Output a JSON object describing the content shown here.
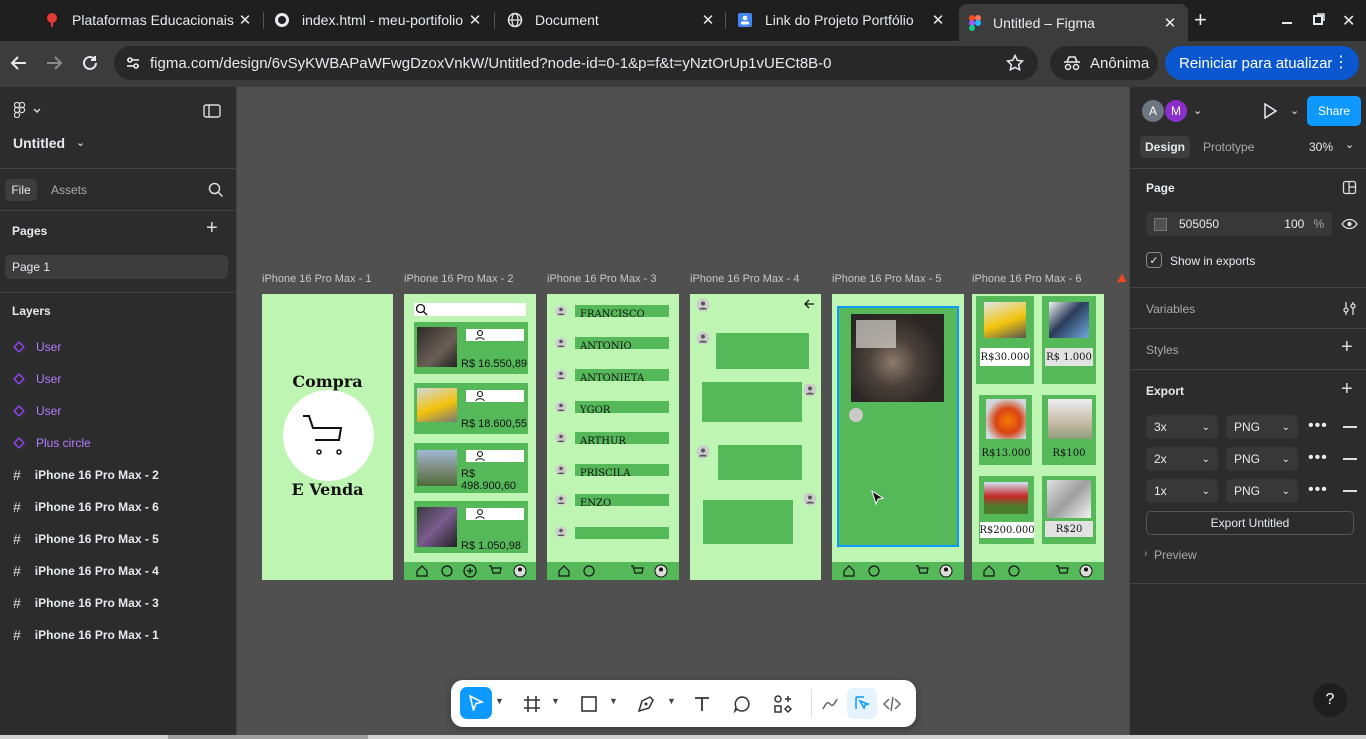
{
  "browser": {
    "tabs": [
      {
        "title": "Plataformas Educacionais",
        "icon": "pin-icon"
      },
      {
        "title": "index.html - meu-portifolio",
        "icon": "github-icon"
      },
      {
        "title": "Document",
        "icon": "globe-icon"
      },
      {
        "title": "Link do Projeto Portfólio",
        "icon": "docs-icon"
      },
      {
        "title": "Untitled – Figma",
        "icon": "figma-icon"
      }
    ],
    "url": "figma.com/design/6vSyKWBAPaWFwgDzoxVnkW/Untitled?node-id=0-1&p=f&t=yNztOrUp1vUECt8B-0",
    "profile_label": "Anônima",
    "update_label": "Reiniciar para atualizar"
  },
  "left_panel": {
    "file_name": "Untitled",
    "tab_file": "File",
    "tab_assets": "Assets",
    "pages_heading": "Pages",
    "page_1": "Page 1",
    "layers_heading": "Layers",
    "layers": [
      {
        "name": "User",
        "kind": "component"
      },
      {
        "name": "User",
        "kind": "component"
      },
      {
        "name": "User",
        "kind": "component"
      },
      {
        "name": "Plus circle",
        "kind": "component"
      },
      {
        "name": "iPhone 16 Pro Max - 2",
        "kind": "frame"
      },
      {
        "name": "iPhone 16 Pro Max - 6",
        "kind": "frame"
      },
      {
        "name": "iPhone 16 Pro Max - 5",
        "kind": "frame"
      },
      {
        "name": "iPhone 16 Pro Max - 4",
        "kind": "frame"
      },
      {
        "name": "iPhone 16 Pro Max - 3",
        "kind": "frame"
      },
      {
        "name": "iPhone 16 Pro Max - 1",
        "kind": "frame"
      }
    ]
  },
  "canvas": {
    "frames": [
      "iPhone 16 Pro Max - 1",
      "iPhone 16 Pro Max - 2",
      "iPhone 16 Pro Max - 3",
      "iPhone 16 Pro Max - 4",
      "iPhone 16 Pro Max - 5",
      "iPhone 16 Pro Max - 6"
    ],
    "f1": {
      "line1": "Compra",
      "line2": "E Venda"
    },
    "f2_prices": [
      "R$ 16.550,89",
      "R$ 18.600,55",
      "R$ 498.900,60",
      "R$ 1.050,98"
    ],
    "f3_names": [
      "FRANCISCO",
      "ANTONIO",
      "ANTONIETA",
      "YGOR",
      "ARTHUR",
      "PRISCILA",
      "ENZO",
      ""
    ],
    "f6_prices": [
      "R$30.000",
      "R$ 1.000",
      "R$13.000",
      "R$100",
      "R$200.000",
      "R$20"
    ]
  },
  "right_panel": {
    "avatars": [
      "A",
      "M"
    ],
    "share_label": "Share",
    "tab_design": "Design",
    "tab_prototype": "Prototype",
    "zoom": "30%",
    "page_heading": "Page",
    "page_color": "505050",
    "page_opacity": "100",
    "percent": "%",
    "show_in_exports": "Show in exports",
    "variables": "Variables",
    "styles": "Styles",
    "export_heading": "Export",
    "exports": [
      {
        "scale": "3x",
        "format": "PNG"
      },
      {
        "scale": "2x",
        "format": "PNG"
      },
      {
        "scale": "1x",
        "format": "PNG"
      }
    ],
    "export_button": "Export Untitled",
    "preview": "Preview",
    "help": "?"
  },
  "colors": {
    "accent": "#0d99ff",
    "frame_bg": "#bff5b2",
    "frame_green": "#55b95a",
    "canvas_bg": "#505050",
    "update_chip": "#0b57d0"
  }
}
